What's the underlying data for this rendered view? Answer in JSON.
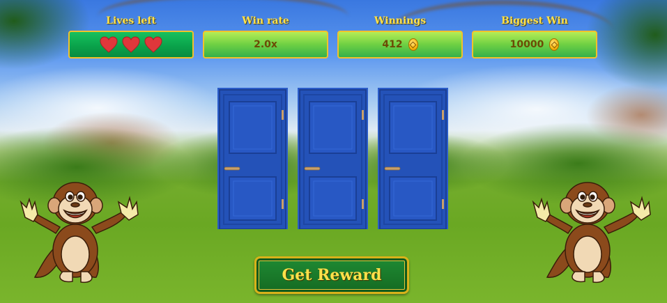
{
  "stats": {
    "lives": {
      "label": "Lives left",
      "count": 3
    },
    "win_rate": {
      "label": "Win rate",
      "value": "2.0x"
    },
    "winnings": {
      "label": "Winnings",
      "value": "412"
    },
    "biggest_win": {
      "label": "Biggest Win",
      "value": "10000"
    }
  },
  "doors": [
    "door-1",
    "door-2",
    "door-3"
  ],
  "reward_button": {
    "label": "Get Reward"
  },
  "colors": {
    "label_text": "#ffe14a",
    "stat_box_border": "#f3c12b",
    "door_blue": "#2452b8",
    "heart_red": "#e0373b",
    "button_green": "#1f7a2c"
  }
}
